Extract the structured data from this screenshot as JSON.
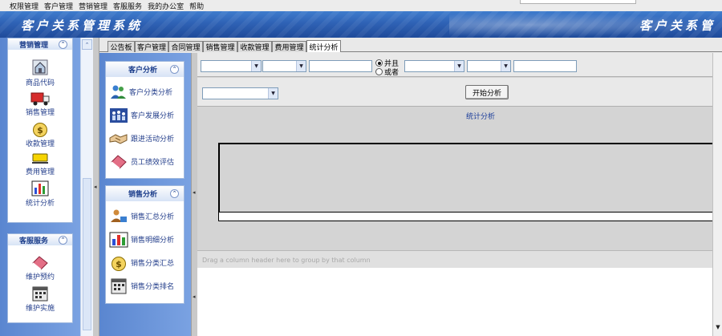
{
  "menu": [
    "权限管理",
    "客户管理",
    "营销管理",
    "客服服务",
    "我的办公室",
    "帮助"
  ],
  "banner": {
    "title": "客户关系管理系统",
    "title_right": "客户关系管"
  },
  "left_nav": {
    "group1": {
      "title": "营销管理",
      "items": [
        {
          "label": "商品代码",
          "icon": "home-icon"
        },
        {
          "label": "销售管理",
          "icon": "truck-icon"
        },
        {
          "label": "收款管理",
          "icon": "money-bag-icon"
        },
        {
          "label": "费用管理",
          "icon": "coin-icon"
        },
        {
          "label": "统计分析",
          "icon": "bar-chart-icon"
        }
      ]
    },
    "group2": {
      "title": "客服服务",
      "items": [
        {
          "label": "维护预约",
          "icon": "eraser-icon"
        },
        {
          "label": "维护实施",
          "icon": "calendar-icon"
        }
      ]
    }
  },
  "tabs": [
    "公告板",
    "客户管理",
    "合同管理",
    "销售管理",
    "收款管理",
    "费用管理",
    "统计分析"
  ],
  "active_tab": "统计分析",
  "analysis_panel": {
    "group1": {
      "title": "客户分析",
      "items": [
        "客户分类分析",
        "客户发展分析",
        "跟进活动分析",
        "员工绩效评估"
      ]
    },
    "group2": {
      "title": "销售分析",
      "items": [
        "销售汇总分析",
        "销售明细分析",
        "销售分类汇总",
        "销售分类排名"
      ]
    }
  },
  "filters": {
    "radio_and": "并且",
    "radio_or": "或者",
    "start_button": "开始分析"
  },
  "main": {
    "section_label": "统计分析",
    "group_hint": "Drag a column header here to group by that column"
  }
}
